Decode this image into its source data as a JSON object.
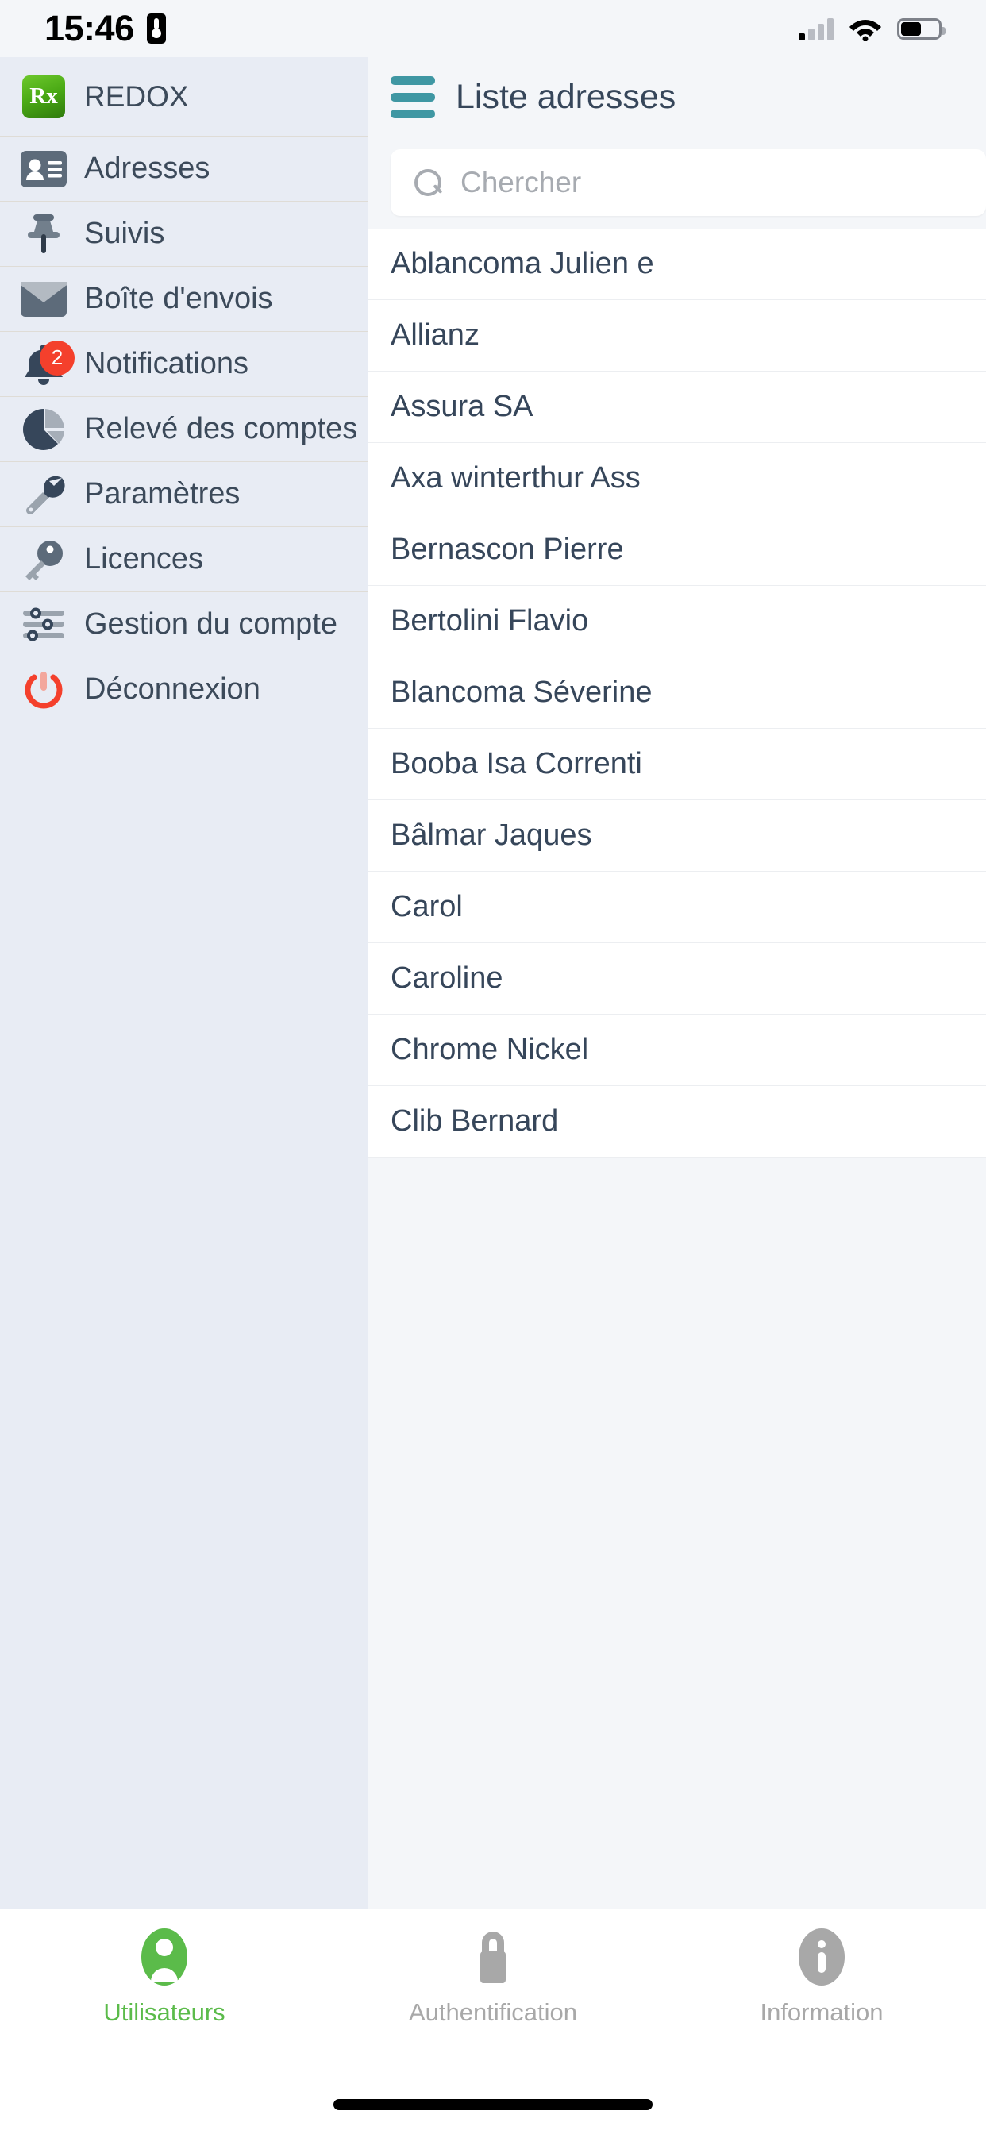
{
  "status_bar": {
    "time": "15:46",
    "lock_icon": "lock-portrait-icon",
    "signal_icon": "cellular-signal-icon",
    "wifi_icon": "wifi-icon",
    "battery_icon": "battery-icon"
  },
  "drawer": {
    "brand": {
      "label": "REDOX",
      "icon": "rx-logo-icon",
      "logo_text": "Rx",
      "logo_color": "#4aa915"
    },
    "items": [
      {
        "label": "Adresses",
        "icon": "contact-card-icon"
      },
      {
        "label": "Suivis",
        "icon": "pushpin-icon"
      },
      {
        "label": "Boîte d'envois",
        "icon": "envelope-icon"
      },
      {
        "label": "Notifications",
        "icon": "bell-icon",
        "badge": "2",
        "badge_color": "#f4402c"
      },
      {
        "label": "Relevé des comptes",
        "icon": "pie-chart-icon"
      },
      {
        "label": "Paramètres",
        "icon": "wrench-icon"
      },
      {
        "label": "Licences",
        "icon": "key-icon"
      },
      {
        "label": "Gestion du compte",
        "icon": "sliders-icon"
      },
      {
        "label": "Déconnexion",
        "icon": "power-icon",
        "icon_color": "#f4402c"
      }
    ]
  },
  "content": {
    "menu_icon": "hamburger-menu-icon",
    "menu_icon_color": "#3f97a3",
    "title": "Liste adresses",
    "search": {
      "icon": "search-icon",
      "placeholder": "Chercher",
      "value": ""
    },
    "list": [
      "Ablancoma Julien e",
      "Allianz",
      "Assura SA",
      "Axa winterthur Ass",
      "Bernascon Pierre",
      "Bertolini Flavio",
      "Blancoma Séverine",
      "Booba Isa Correnti",
      "Bâlmar Jaques",
      "Carol",
      "Caroline",
      "Chrome Nickel",
      "Clib Bernard"
    ]
  },
  "tabbar": {
    "tabs": [
      {
        "label": "Utilisateurs",
        "icon": "person-icon",
        "active": true,
        "color": "#5bbb4a"
      },
      {
        "label": "Authentification",
        "icon": "lock-icon",
        "active": false,
        "color": "#a8a8a8"
      },
      {
        "label": "Information",
        "icon": "info-icon",
        "active": false,
        "color": "#a8a8a8"
      }
    ],
    "home_indicator": "home-indicator"
  }
}
